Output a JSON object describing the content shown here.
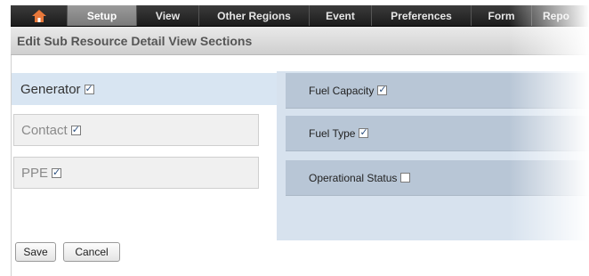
{
  "nav": {
    "home_icon": "home-icon",
    "items": [
      {
        "label": "Setup",
        "active": true
      },
      {
        "label": "View",
        "active": false
      },
      {
        "label": "Other Regions",
        "active": false
      },
      {
        "label": "Event",
        "active": false
      },
      {
        "label": "Preferences",
        "active": false
      },
      {
        "label": "Form",
        "active": false
      },
      {
        "label": "Repo",
        "active": false
      }
    ]
  },
  "header": {
    "title": "Edit Sub Resource Detail View Sections"
  },
  "sections": [
    {
      "label": "Generator",
      "checked": true,
      "selected": true
    },
    {
      "label": "Contact",
      "checked": true,
      "selected": false
    },
    {
      "label": "PPE",
      "checked": true,
      "selected": false
    }
  ],
  "fields": [
    {
      "label": "Fuel Capacity",
      "checked": true
    },
    {
      "label": "Fuel Type",
      "checked": true
    },
    {
      "label": "Operational Status",
      "checked": false
    }
  ],
  "buttons": {
    "save": "Save",
    "cancel": "Cancel"
  },
  "colors": {
    "nav_bg": "#2a2a2a",
    "nav_active": "#8a8a8a",
    "selected_section": "#d8e5f2",
    "panel_bg": "#d7e2ee",
    "field_row": "#b8c6d6"
  }
}
